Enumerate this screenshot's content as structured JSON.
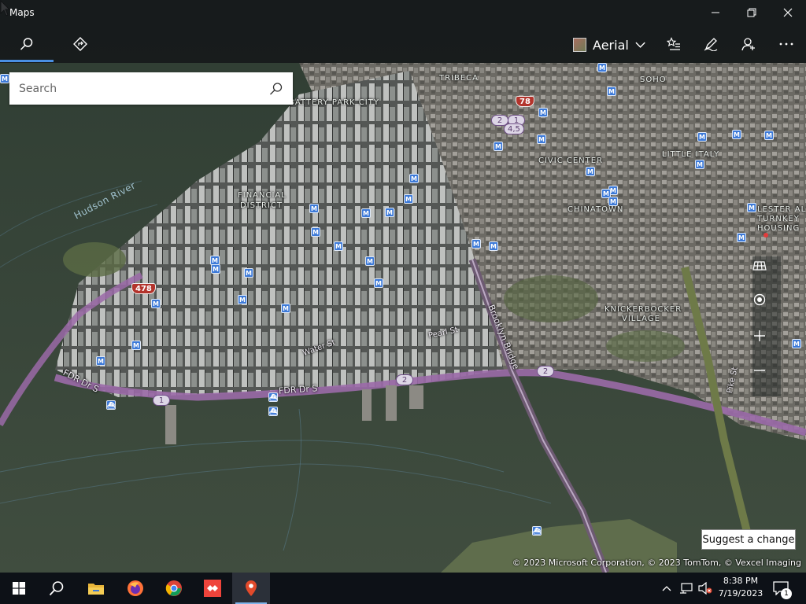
{
  "window": {
    "title": "Maps",
    "minimize_icon": "minimize-icon",
    "restore_icon": "restore-icon",
    "close_icon": "close-icon"
  },
  "toolbar": {
    "tabs": [
      {
        "icon": "search-icon",
        "active": true
      },
      {
        "icon": "directions-icon",
        "active": false
      }
    ],
    "map_style": "Aerial",
    "actions": [
      "favorites-icon",
      "ink-pen-icon",
      "account-icon",
      "more-icon"
    ]
  },
  "search": {
    "placeholder": "Search"
  },
  "map": {
    "neighborhoods": [
      "TRIBECA",
      "SOHO",
      "BATTERY PARK CITY",
      "FINANCIAL DISTRICT",
      "CIVIC CENTER",
      "LITTLE ITALY",
      "CHINATOWN",
      "LESTER ALLEN",
      "TURNKEY",
      "HOUSING",
      "KNICKERBOCKER",
      "VILLAGE"
    ],
    "water": [
      "Hudson River"
    ],
    "roads": [
      "FDR Dr S",
      "FDR Dr S",
      "Brooklyn Bridge",
      "Pearl St",
      "Water St",
      "Pike St"
    ],
    "shields": {
      "route_1": "1",
      "route_2a": "2",
      "route_2b": "2",
      "route_2c": "2",
      "route_1b": "1",
      "route_45": "4,5",
      "interstate_478": "478",
      "interstate_78": "78"
    },
    "metro_label": "M",
    "controls": [
      "grid-3d-icon",
      "locate-icon",
      "zoom-in-icon",
      "zoom-out-icon"
    ],
    "colors": {
      "water": "#3b4a3d",
      "highway": "#9b6aa8",
      "metro": "#3d7ad8"
    }
  },
  "footer": {
    "suggest_change": "Suggest a change",
    "copyright": "© 2023 Microsoft Corporation, © 2023 TomTom, © Vexcel Imaging"
  },
  "taskbar": {
    "apps": [
      "windows-start-icon",
      "search-icon",
      "file-explorer-icon",
      "firefox-icon",
      "chrome-icon",
      "anydesk-icon",
      "maps-icon"
    ],
    "time": "8:38 PM",
    "date": "7/19/2023",
    "notification_count": "1"
  }
}
